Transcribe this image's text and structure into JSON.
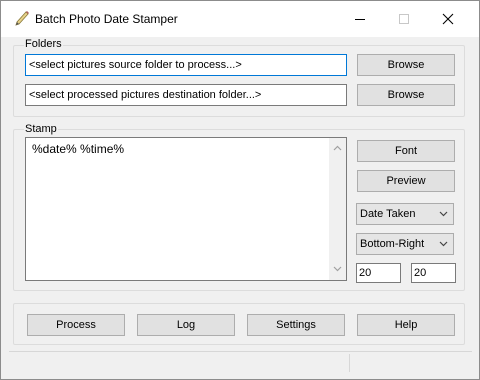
{
  "window": {
    "title": "Batch Photo Date Stamper"
  },
  "folders": {
    "label": "Folders",
    "source_value": "<select pictures source folder to process...>",
    "destination_value": "<select processed pictures destination folder...>",
    "browse_label": "Browse"
  },
  "stamp": {
    "label": "Stamp",
    "text": "%date% %time%",
    "font_label": "Font",
    "preview_label": "Preview",
    "date_source": "Date Taken",
    "position": "Bottom-Right",
    "offset_x": "20",
    "offset_y": "20"
  },
  "actions": {
    "process_label": "Process",
    "log_label": "Log",
    "settings_label": "Settings",
    "help_label": "Help"
  },
  "icons": {
    "app": "pen-icon",
    "minimize": "minimize-icon",
    "maximize": "maximize-icon",
    "close": "close-icon"
  },
  "colors": {
    "focus_border": "#0078d7",
    "window_bg": "#f0f0f0"
  }
}
